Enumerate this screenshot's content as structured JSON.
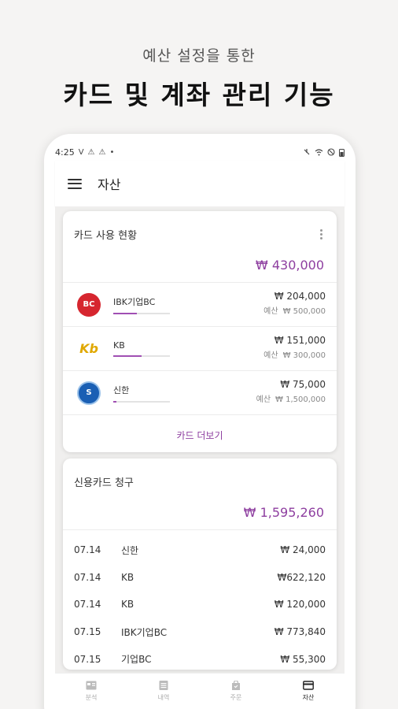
{
  "promo": {
    "subtitle": "예산 설정을 통한",
    "title": "카드 및 계좌 관리 기능"
  },
  "status_bar": {
    "time": "4:25",
    "left_icons": [
      "V",
      "⚠",
      "⚠",
      "•"
    ]
  },
  "app_bar": {
    "title": "자산"
  },
  "card_usage": {
    "title": "카드 사용 현황",
    "total": "₩ 430,000",
    "budget_label": "예산",
    "cards": [
      {
        "name": "IBK기업BC",
        "amount": "₩ 204,000",
        "budget": "₩ 500,000",
        "progress": 0.41,
        "logo": "BC"
      },
      {
        "name": "KB",
        "amount": "₩ 151,000",
        "budget": "₩ 300,000",
        "progress": 0.5,
        "logo": "Kb"
      },
      {
        "name": "신한",
        "amount": "₩ 75,000",
        "budget": "₩ 1,500,000",
        "progress": 0.05,
        "logo": "S"
      }
    ],
    "more_label": "카드 더보기"
  },
  "credit_bill": {
    "title": "신용카드 청구",
    "total": "₩ 1,595,260",
    "rows": [
      {
        "date": "07.14",
        "name": "신한",
        "amount": "₩ 24,000"
      },
      {
        "date": "07.14",
        "name": "KB",
        "amount": "₩622,120"
      },
      {
        "date": "07.14",
        "name": "KB",
        "amount": "₩ 120,000"
      },
      {
        "date": "07.15",
        "name": "IBK기업BC",
        "amount": "₩ 773,840"
      },
      {
        "date": "07.15",
        "name": "기업BC",
        "amount": "₩ 55,300"
      }
    ]
  },
  "bottom_nav": {
    "items": [
      {
        "label": "분석",
        "icon": "analysis-icon"
      },
      {
        "label": "내역",
        "icon": "history-icon"
      },
      {
        "label": "주문",
        "icon": "order-icon"
      },
      {
        "label": "자산",
        "icon": "card-icon"
      }
    ],
    "active": "자산"
  },
  "colors": {
    "accent": "#8e3fa0",
    "bc_red": "#d6262f",
    "kb_yellow": "#e0a800",
    "shinhan_blue": "#1a5fb4"
  }
}
